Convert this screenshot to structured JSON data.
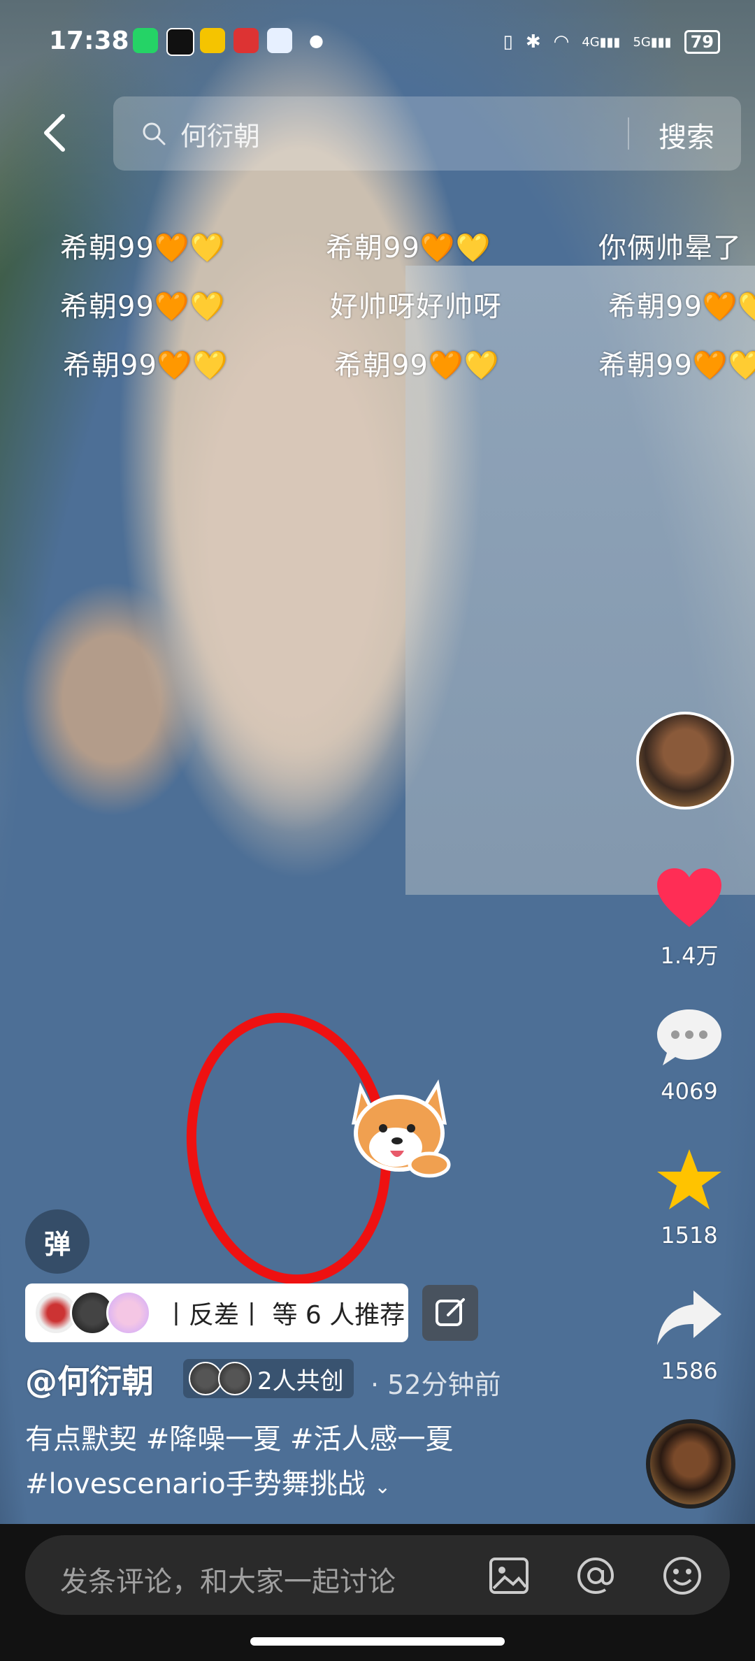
{
  "status_bar": {
    "time": "17:38",
    "network_1": "4G",
    "network_2": "5G",
    "battery": "79"
  },
  "search": {
    "query": "何衍朝",
    "button": "搜索"
  },
  "danmaku": [
    "希朝99🧡💛",
    "希朝99🧡💛",
    "你俩帅晕了",
    "希朝99🧡💛",
    "好帅呀好帅呀",
    "希朝99🧡💛",
    "希朝99🧡💛",
    "希朝99🧡💛",
    "希朝99🧡💛"
  ],
  "rail": {
    "likes": "1.4万",
    "comments": "4069",
    "favorites": "1518",
    "shares": "1586"
  },
  "danmu_toggle": "弹",
  "recommend": {
    "text": "丨反差丨 等 6 人推荐"
  },
  "post": {
    "author": "@何衍朝",
    "co_create": "2人共创",
    "time": "· 52分钟前",
    "desc_line1": "有点默契 #降噪一夏 #活人感一夏",
    "desc_line2": "#lovescenario手势舞挑战"
  },
  "comment_bar": {
    "placeholder": "发条评论，和大家一起讨论"
  },
  "colors": {
    "like": "#ff2d55",
    "favorite": "#ffc300",
    "annotation": "#e11111"
  }
}
